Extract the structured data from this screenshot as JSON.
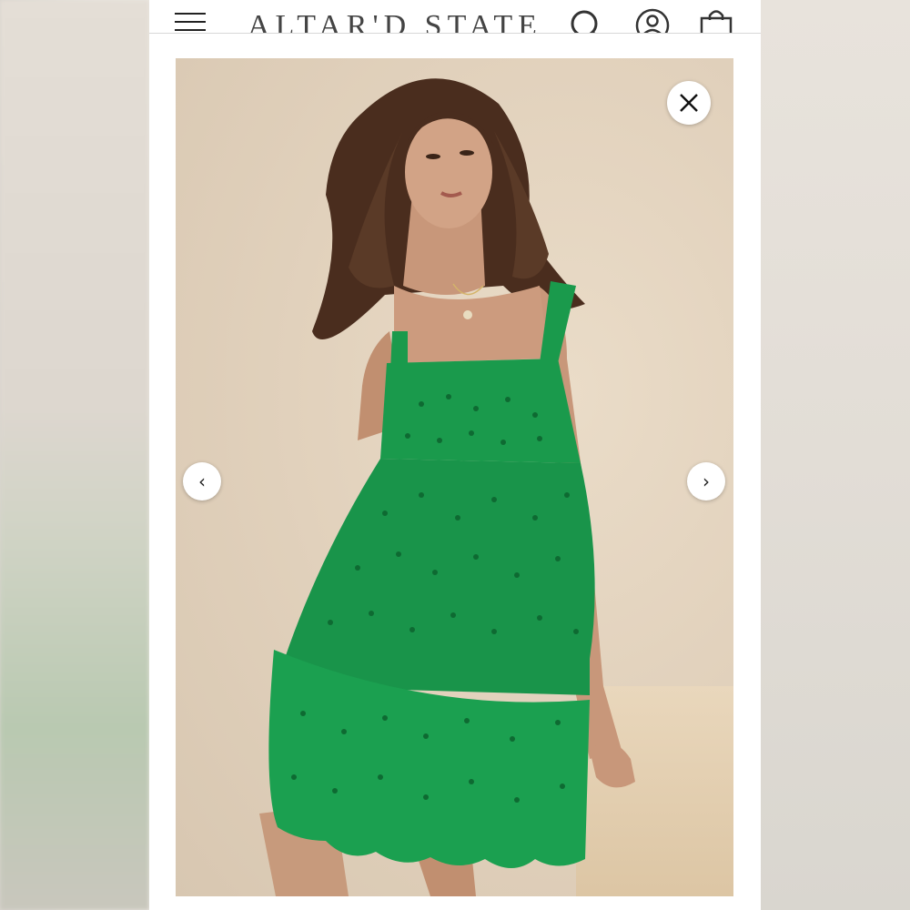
{
  "header": {
    "brand": "ALTAR'D STATE",
    "menu_icon": "hamburger-menu-icon",
    "search_icon": "search-icon",
    "account_icon": "user-icon",
    "cart_icon": "shopping-bag-icon"
  },
  "viewer": {
    "close_icon": "close-icon",
    "prev_glyph": "‹",
    "next_glyph": "›",
    "image_subject": "model wearing green eyelet tiered mini dress"
  },
  "colors": {
    "dress": "#1a9a4c",
    "wall": "#e3d4c1",
    "frame": "#ffffff",
    "text": "#444444"
  }
}
